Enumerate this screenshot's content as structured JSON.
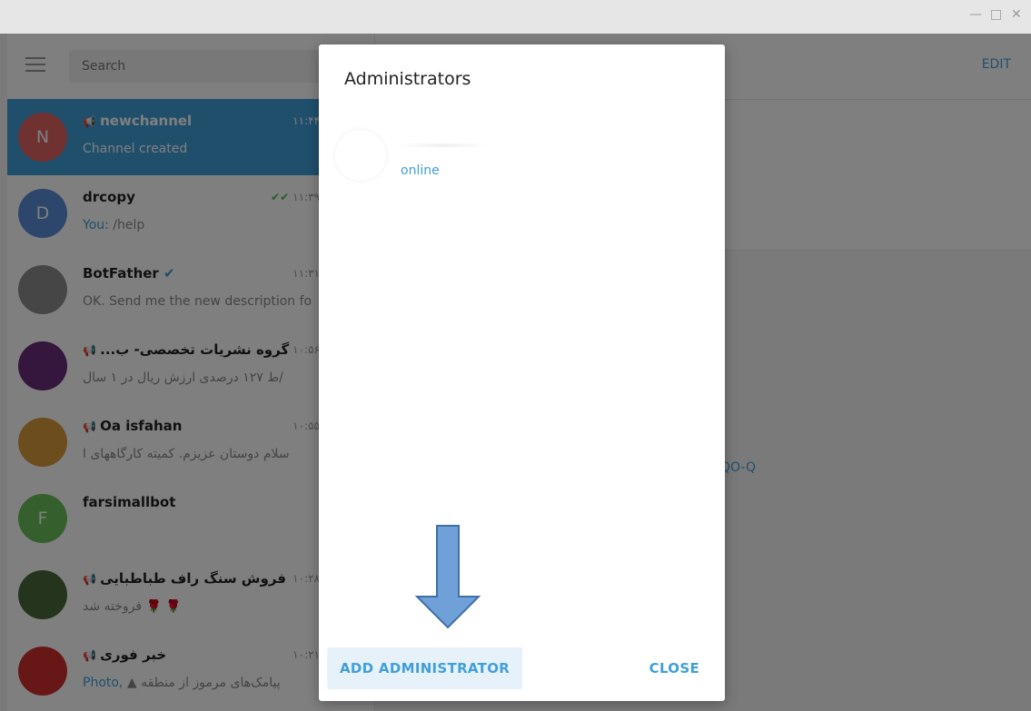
{
  "window": {
    "controls": {
      "minimize": "—",
      "maximize": "□",
      "close": "✕"
    }
  },
  "sidebar": {
    "search_placeholder": "Search",
    "chats": [
      {
        "initial": "N",
        "avatar_color": "#e06363",
        "name": "newchannel",
        "is_channel": true,
        "time": "۱۱:۴۴",
        "message": "Channel created",
        "active": true
      },
      {
        "initial": "D",
        "avatar_color": "#5a8fd8",
        "name": "drcopy",
        "time": "۱۱:۳۹",
        "read_ticks": "✔✔",
        "message_prefix": "You:",
        "message": " /help"
      },
      {
        "initial": "",
        "avatar_color": "#8d8d8d",
        "name": "BotFather",
        "verified": true,
        "time": "۱۱:۳۱",
        "message": "OK. Send me the new description fo"
      },
      {
        "initial": "",
        "avatar_color": "#6a2c7a",
        "name": "...گروه نشریات تخصصی- ب",
        "is_channel": true,
        "time": "۱۰:۵۶",
        "message": "ط ۱۲۷ درصدی ارزش ریال در ۱ سال/"
      },
      {
        "initial": "",
        "avatar_color": "#d89a3a",
        "name": "Oa isfahan",
        "is_channel": true,
        "time": "۱۰:۵۵",
        "message": "سلام دوستان عزیزم. کمیته کارگاههای ا"
      },
      {
        "initial": "F",
        "avatar_color": "#6bbf5a",
        "name": "farsimallbot",
        "time": "",
        "message": ""
      },
      {
        "initial": "",
        "avatar_color": "#4a6b3a",
        "name": "فروش سنگ راف طباطبایی",
        "is_channel": true,
        "time": "۱۰:۲۸",
        "message": "فروخته شد 🌹 🌹"
      },
      {
        "initial": "",
        "avatar_color": "#d12e2e",
        "name": "خبر فوری",
        "is_channel": true,
        "time": "۱۰:۲۱",
        "message_prefix": "Photo,",
        "message": " ▲ پیامک‌های مرموز از منطقه"
      }
    ]
  },
  "main": {
    "edit_label": "EDIT",
    "link_fragment": "QO-Q"
  },
  "dialog": {
    "title": "Administrators",
    "admin": {
      "status": "online"
    },
    "add_button": "ADD ADMINISTRATOR",
    "close_button": "CLOSE"
  },
  "colors": {
    "accent": "#419fd9",
    "arrow_fill": "#6fa0d8",
    "arrow_stroke": "#3e6fa5"
  }
}
